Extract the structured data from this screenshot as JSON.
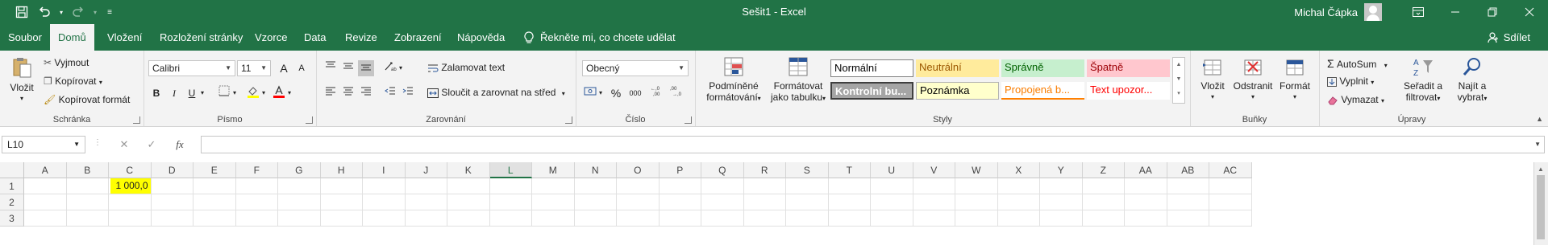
{
  "app": {
    "title": "Sešit1  -  Excel",
    "user_name": "Michal Čápka",
    "share_label": "Sdílet",
    "tell_me": "Řekněte mi, co chcete udělat"
  },
  "tabs": [
    "Soubor",
    "Domů",
    "Vložení",
    "Rozložení stránky",
    "Vzorce",
    "Data",
    "Revize",
    "Zobrazení",
    "Nápověda"
  ],
  "ribbon": {
    "clipboard": {
      "label": "Schránka",
      "paste": "Vložit",
      "cut": "Vyjmout",
      "copy": "Kopírovat",
      "format_painter": "Kopírovat formát"
    },
    "font": {
      "label": "Písmo",
      "name": "Calibri",
      "size": "11",
      "bold": "B",
      "italic": "I",
      "underline": "U",
      "grow": "A",
      "shrink": "A"
    },
    "alignment": {
      "label": "Zarovnání",
      "wrap": "Zalamovat text",
      "merge": "Sloučit a zarovnat na střed"
    },
    "number": {
      "label": "Číslo",
      "format": "Obecný",
      "percent": "%",
      "thousands": "000"
    },
    "styles": {
      "label": "Styly",
      "conditional_line1": "Podmíněné",
      "conditional_line2": "formátování",
      "table_line1": "Formátovat",
      "table_line2": "jako tabulku",
      "cells": [
        {
          "text": "Normální",
          "bg": "#ffffff",
          "fg": "#000000"
        },
        {
          "text": "Neutrální",
          "bg": "#ffeb9c",
          "fg": "#9c5700"
        },
        {
          "text": "Správně",
          "bg": "#c6efce",
          "fg": "#006100"
        },
        {
          "text": "Špatně",
          "bg": "#ffc7ce",
          "fg": "#9c0006"
        },
        {
          "text": "Kontrolní bu...",
          "bg": "#a5a5a5",
          "fg": "#ffffff"
        },
        {
          "text": "Poznámka",
          "bg": "#ffffcc",
          "fg": "#000000"
        },
        {
          "text": "Propojená b...",
          "bg": "#ffffff",
          "fg": "#fa7d00"
        },
        {
          "text": "Text upozor...",
          "bg": "#ffffff",
          "fg": "#ff0000"
        }
      ]
    },
    "cells": {
      "label": "Buňky",
      "insert": "Vložit",
      "delete": "Odstranit",
      "format": "Formát"
    },
    "editing": {
      "label": "Úpravy",
      "autosum": "AutoSum",
      "fill": "Vyplnit",
      "clear": "Vymazat",
      "sort_line1": "Seřadit a",
      "sort_line2": "filtrovat",
      "find_line1": "Najít a",
      "find_line2": "vybrat"
    }
  },
  "formula_bar": {
    "name_box": "L10",
    "fx": "fx",
    "content": ""
  },
  "sheet": {
    "columns": [
      "A",
      "B",
      "C",
      "D",
      "E",
      "F",
      "G",
      "H",
      "I",
      "J",
      "K",
      "L",
      "M",
      "N",
      "O",
      "P",
      "Q",
      "R",
      "S",
      "T",
      "U",
      "V",
      "W",
      "X",
      "Y",
      "Z",
      "AA",
      "AB",
      "AC"
    ],
    "selected_column": "L",
    "rows": [
      "1",
      "2",
      "3"
    ],
    "cells": [
      {
        "ref": "C1",
        "value": "1 000,0",
        "fill": "#ffff00"
      }
    ]
  },
  "colors": {
    "brand": "#217346",
    "highlight": "#ffff00"
  }
}
